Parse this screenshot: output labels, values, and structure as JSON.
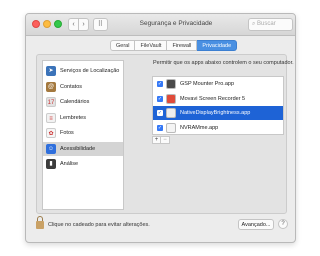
{
  "window": {
    "title": "Segurança e Privacidade",
    "search_placeholder": "Buscar",
    "back_glyph": "‹",
    "forward_glyph": "›",
    "grid_glyph": "⠿"
  },
  "tabs": [
    {
      "label": "Geral",
      "active": false
    },
    {
      "label": "FileVault",
      "active": false
    },
    {
      "label": "Firewall",
      "active": false
    },
    {
      "label": "Privacidade",
      "active": true
    }
  ],
  "sidebar": {
    "items": [
      {
        "label": "Serviços de Localização",
        "icon": "location-icon",
        "glyph": "➤",
        "color": "#3b73b9",
        "selected": false
      },
      {
        "label": "Contatos",
        "icon": "contacts-icon",
        "glyph": "@",
        "color": "#a4793f",
        "selected": false
      },
      {
        "label": "Calendários",
        "icon": "calendar-icon",
        "glyph": "17",
        "color": "#e2e2e2",
        "selected": false
      },
      {
        "label": "Lembretes",
        "icon": "reminders-icon",
        "glyph": "≡",
        "color": "#f2f2f2",
        "selected": false
      },
      {
        "label": "Fotos",
        "icon": "photos-icon",
        "glyph": "✿",
        "color": "#f6f6f6",
        "selected": false
      },
      {
        "label": "Acessibilidade",
        "icon": "accessibility-icon",
        "glyph": "☺",
        "color": "#2f6fdc",
        "selected": true
      },
      {
        "label": "Análise",
        "icon": "analytics-icon",
        "glyph": "▮",
        "color": "#3c3c3c",
        "selected": false
      }
    ]
  },
  "pane": {
    "description": "Permitir que os apps abaixo controlem o seu computador.",
    "apps": [
      {
        "name": "GSP Mounter Pro.app",
        "checked": true,
        "selected": false,
        "icon": "app-mounter-icon",
        "color": "#4a4a4a"
      },
      {
        "name": "Movavi Screen Recorder 5",
        "checked": true,
        "selected": false,
        "icon": "app-movavi-icon",
        "color": "#e04b3a"
      },
      {
        "name": "NativeDisplayBrightness.app",
        "checked": true,
        "selected": true,
        "icon": "app-brightness-icon",
        "color": "#eeeeee"
      },
      {
        "name": "NVRAMme.app",
        "checked": true,
        "selected": false,
        "icon": "app-nvram-icon",
        "color": "#f4f4f4"
      }
    ],
    "add_label": "+",
    "remove_label": "−",
    "check_glyph": "✓"
  },
  "footer": {
    "lock_text": "Clique no cadeado para evitar alterações.",
    "advanced_label": "Avançado...",
    "help_label": "?"
  },
  "colors": {
    "accent": "#3478f6",
    "selection": "#1e63d6"
  }
}
